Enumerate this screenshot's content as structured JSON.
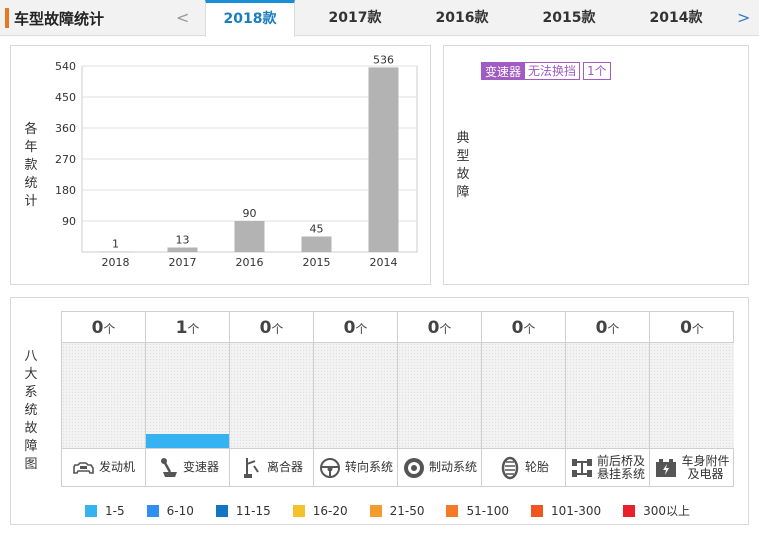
{
  "header": {
    "title": "车型故障统计",
    "prev_arrow": "<",
    "next_arrow": ">",
    "year_tabs": [
      {
        "label": "2018款",
        "active": true
      },
      {
        "label": "2017款",
        "active": false
      },
      {
        "label": "2016款",
        "active": false
      },
      {
        "label": "2015款",
        "active": false
      },
      {
        "label": "2014款",
        "active": false
      }
    ]
  },
  "yearly_chart": {
    "side_label": "各年款统计",
    "chart_data": {
      "type": "bar",
      "categories": [
        "2018",
        "2017",
        "2016",
        "2015",
        "2014"
      ],
      "values": [
        1,
        13,
        90,
        45,
        536
      ],
      "yticks": [
        90,
        180,
        270,
        360,
        450,
        540
      ],
      "ylim": [
        0,
        540
      ],
      "grid": true,
      "bar_color": "#b3b3b3"
    }
  },
  "typical_faults": {
    "side_label": "典型故障",
    "tags": [
      {
        "category": "变速器",
        "name": "无法换挡",
        "count": "1个"
      }
    ],
    "accent_color": "#a05cc2"
  },
  "systems": {
    "side_label": "八大系统故障图",
    "unit": "个",
    "items": [
      {
        "name": "发动机",
        "count": "0",
        "icon": "engine-icon",
        "level": 0
      },
      {
        "name": "变速器",
        "count": "1",
        "icon": "gear-shift-icon",
        "level": 1
      },
      {
        "name": "离合器",
        "count": "0",
        "icon": "clutch-pedal-icon",
        "level": 0
      },
      {
        "name": "转向系统",
        "count": "0",
        "icon": "steering-wheel-icon",
        "level": 0
      },
      {
        "name": "制动系统",
        "count": "0",
        "icon": "brake-disc-icon",
        "level": 0
      },
      {
        "name": "轮胎",
        "count": "0",
        "icon": "tire-icon",
        "level": 0
      },
      {
        "name_line1": "前后桥及",
        "name_line2": "悬挂系统",
        "count": "0",
        "icon": "axle-suspension-icon",
        "level": 0
      },
      {
        "name_line1": "车身附件",
        "name_line2": "及电器",
        "count": "0",
        "icon": "battery-icon",
        "level": 0
      }
    ],
    "legend": [
      {
        "label": "1-5",
        "color": "#35b2f2"
      },
      {
        "label": "6-10",
        "color": "#2f8ff0"
      },
      {
        "label": "11-15",
        "color": "#1375c4"
      },
      {
        "label": "16-20",
        "color": "#f5c12b"
      },
      {
        "label": "21-50",
        "color": "#f59a2f"
      },
      {
        "label": "51-100",
        "color": "#f37b28"
      },
      {
        "label": "101-300",
        "color": "#f0561e"
      },
      {
        "label": "300以上",
        "color": "#e8202a"
      }
    ]
  }
}
